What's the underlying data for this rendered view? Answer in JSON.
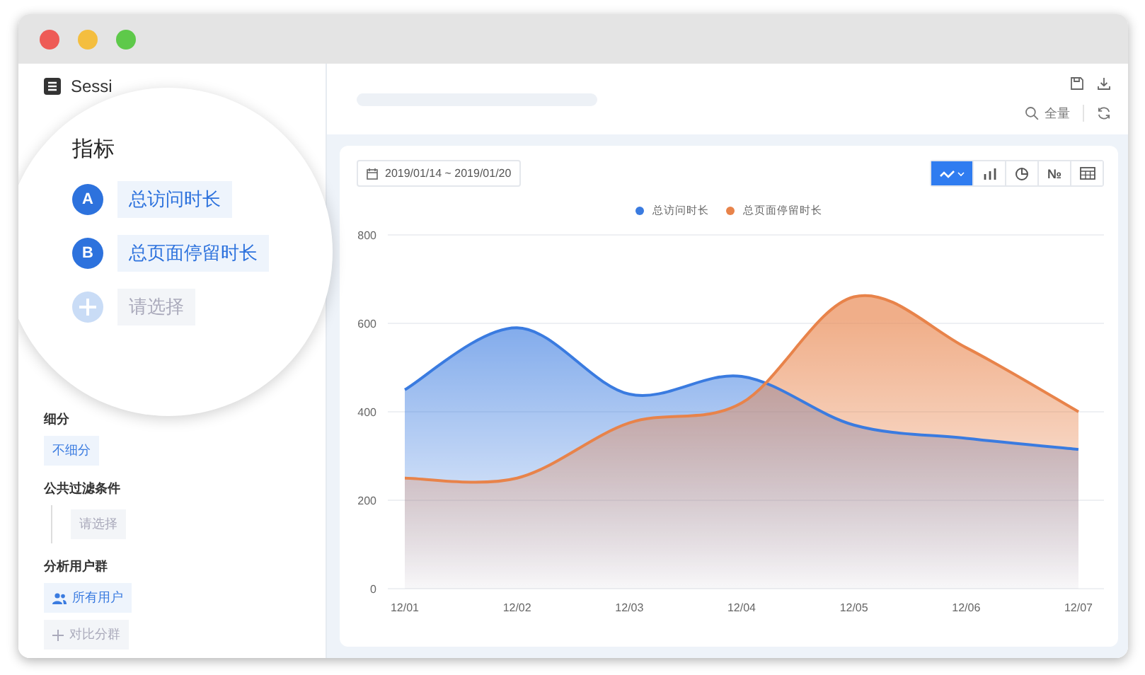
{
  "sidebar": {
    "title": "Sessi",
    "metrics_popup": {
      "heading": "指标",
      "metrics": [
        {
          "kind": "metric",
          "badge": "A",
          "name": "总访问时长"
        },
        {
          "kind": "metric",
          "badge": "B",
          "name": "总页面停留时长"
        },
        {
          "kind": "add",
          "name": "请选择"
        }
      ]
    },
    "sections": [
      {
        "label": "细分",
        "items": [
          {
            "kind": "chip",
            "text": "不细分"
          }
        ]
      },
      {
        "label": "公共过滤条件",
        "items": [
          {
            "kind": "filter",
            "text": "请选择"
          }
        ]
      },
      {
        "label": "分析用户群",
        "items": [
          {
            "kind": "group",
            "text": "所有用户"
          },
          {
            "kind": "add",
            "text": "对比分群"
          }
        ]
      }
    ]
  },
  "header": {
    "scope": "全量"
  },
  "chart_panel": {
    "date_range": "2019/01/14 ~ 2019/01/20",
    "chart_types": [
      {
        "kind": "line",
        "selected": true
      },
      {
        "kind": "bar",
        "selected": false
      },
      {
        "kind": "pie",
        "selected": false
      },
      {
        "kind": "number",
        "label": "№",
        "selected": false
      },
      {
        "kind": "table",
        "selected": false
      }
    ],
    "chart_data": {
      "type": "area",
      "categories": [
        "12/01",
        "12/02",
        "12/03",
        "12/04",
        "12/05",
        "12/06",
        "12/07"
      ],
      "ylim": [
        0,
        800
      ],
      "yticks": [
        0,
        200,
        400,
        600,
        800
      ],
      "grid": true,
      "series": [
        {
          "name": "总访问时长",
          "color": "#3a7be0",
          "values": [
            450,
            590,
            440,
            480,
            370,
            340,
            315
          ]
        },
        {
          "name": "总页面停留时长",
          "color": "#e8834a",
          "values": [
            250,
            250,
            375,
            420,
            660,
            545,
            400
          ]
        }
      ]
    }
  }
}
